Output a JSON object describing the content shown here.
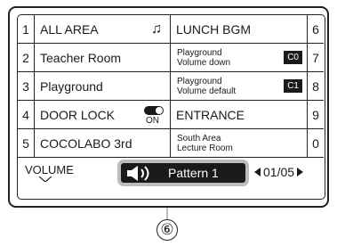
{
  "left_items": [
    {
      "num": "1",
      "label": "ALL AREA",
      "icon": "music-note-icon"
    },
    {
      "num": "2",
      "label": "Teacher Room"
    },
    {
      "num": "3",
      "label": "Playground"
    },
    {
      "num": "4",
      "label": "DOOR LOCK",
      "toggle_text": "ON"
    },
    {
      "num": "5",
      "label": "COCOLABO 3rd"
    }
  ],
  "right_items": [
    {
      "num": "6",
      "label": "LUNCH BGM"
    },
    {
      "num": "7",
      "line1": "Playground",
      "line2": "Volume down",
      "code": "C0"
    },
    {
      "num": "8",
      "line1": "Playground",
      "line2": "Volume default",
      "code": "C1"
    },
    {
      "num": "9",
      "label": "ENTRANCE"
    },
    {
      "num": "0",
      "line1": "South Area",
      "line2": "Lecture Room"
    }
  ],
  "bottom": {
    "volume_label": "VOLUME",
    "pattern_label": "Pattern 1",
    "page_indicator": "01/05"
  },
  "callout": "⑥"
}
